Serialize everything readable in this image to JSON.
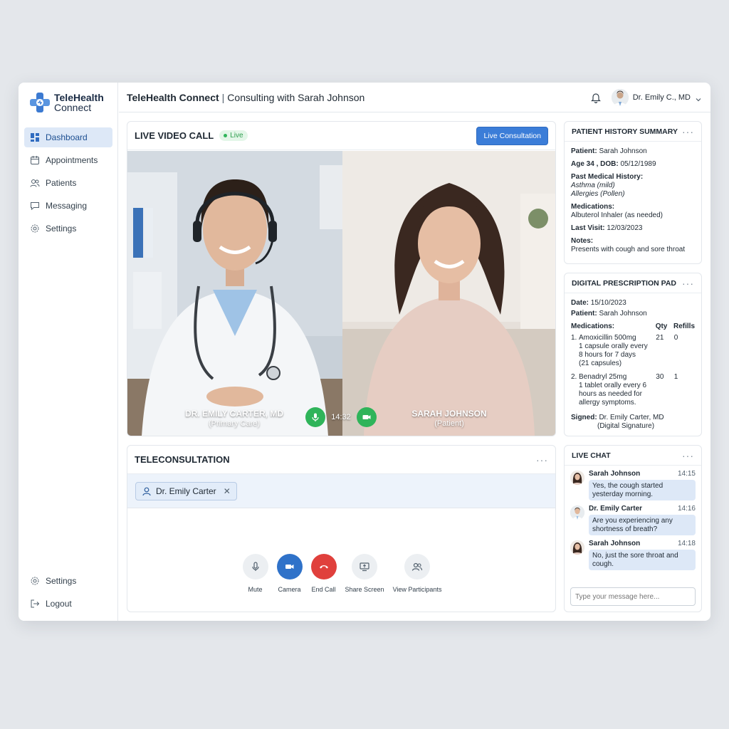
{
  "brand": {
    "line1": "TeleHealth",
    "line2": "Connect"
  },
  "sidebar": {
    "items": [
      {
        "label": "Dashboard",
        "icon": "dashboard-icon",
        "active": true
      },
      {
        "label": "Appointments",
        "icon": "calendar-icon"
      },
      {
        "label": "Patients",
        "icon": "users-icon"
      },
      {
        "label": "Messaging",
        "icon": "message-icon"
      },
      {
        "label": "Settings",
        "icon": "gear-icon"
      }
    ],
    "bottom": [
      {
        "label": "Settings",
        "icon": "gear-icon"
      },
      {
        "label": "Logout",
        "icon": "logout-icon"
      }
    ]
  },
  "header": {
    "app_name": "TeleHealth Connect",
    "separator": "|",
    "context": "Consulting with Sarah Johnson",
    "user_name": "Dr. Emily C., MD"
  },
  "video": {
    "title": "LIVE VIDEO CALL",
    "live_badge": "Live",
    "button": "Live Consultation",
    "left_name": "DR. EMILY CARTER, MD",
    "left_role": "(Primary Care)",
    "right_name": "SARAH JOHNSON",
    "right_role": "(Patient)",
    "timer": "14:32"
  },
  "tele": {
    "title": "TELECONSULTATION",
    "chip": "Dr. Emily Carter",
    "controls": {
      "mute": "Mute",
      "camera": "Camera",
      "end": "End Call",
      "share": "Share Screen",
      "participants": "View Participants"
    }
  },
  "history": {
    "title": "PATIENT HISTORY SUMMARY",
    "patient_label": "Patient:",
    "patient": "Sarah Johnson",
    "age_label": "Age 34 , DOB:",
    "dob": "05/12/1989",
    "pmh_label": "Past Medical History:",
    "pmh1": "Asthma (mild)",
    "pmh2": "Allergies (Pollen)",
    "meds_label": "Medications:",
    "meds": "Albuterol Inhaler (as needed)",
    "last_visit_label": "Last Visit:",
    "last_visit": "12/03/2023",
    "notes_label": "Notes:",
    "notes": "Presents with cough and sore throat"
  },
  "rx": {
    "title": "DIGITAL PRESCRIPTION PAD",
    "date_label": "Date:",
    "date": "15/10/2023",
    "patient_label": "Patient:",
    "patient": "Sarah Johnson",
    "meds_label": "Medications:",
    "qty_label": "Qty",
    "refills_label": "Refills",
    "items": [
      {
        "num": "1.",
        "name": "Amoxicillin 500mg",
        "d1": "1 capsule orally every",
        "d2": "8 hours for 7 days",
        "d3": "(21 capsules)",
        "qty": "21",
        "refills": "0"
      },
      {
        "num": "2.",
        "name": "Benadryl 25mg",
        "d1": "1 tablet orally every 6",
        "d2": "hours as needed for",
        "d3": "allergy symptoms.",
        "qty": "30",
        "refills": "1"
      }
    ],
    "signed_label": "Signed:",
    "signed": "Dr. Emily Carter, MD",
    "signature_note": "(Digital Signature)"
  },
  "chat": {
    "title": "LIVE CHAT",
    "messages": [
      {
        "name": "Sarah Johnson",
        "time": "14:15",
        "text": "Yes, the cough started yesterday morning."
      },
      {
        "name": "Dr. Emily Carter",
        "time": "14:16",
        "text": "Are you experiencing any shortness of breath?"
      },
      {
        "name": "Sarah Johnson",
        "time": "14:18",
        "text": "No, just the sore throat and cough."
      }
    ],
    "placeholder": "Type your message here..."
  },
  "colors": {
    "accent": "#3b7dd8",
    "live": "#2fb45a",
    "end_call": "#e0403c",
    "active_nav": "#dde8f7"
  }
}
